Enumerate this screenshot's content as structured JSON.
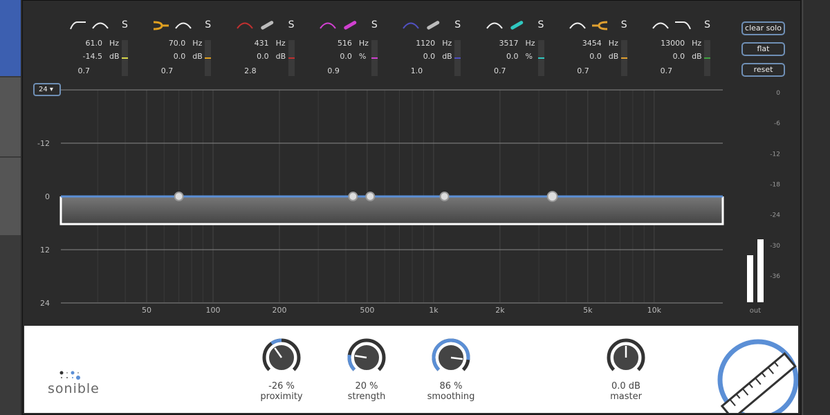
{
  "bands": [
    {
      "freq": "61.0",
      "gain": "-14.5",
      "gain_unit": "dB",
      "q": "0.7",
      "solo": "S",
      "color": "#d8d84a",
      "icons": [
        "highpass-shape-icon",
        "bell-shape-icon"
      ]
    },
    {
      "freq": "70.0",
      "gain": "0.0",
      "gain_unit": "dB",
      "q": "0.7",
      "solo": "S",
      "color": "#e0a020",
      "icons": [
        "smart-filter-icon",
        "bell-shape-icon"
      ]
    },
    {
      "freq": "431",
      "gain": "0.0",
      "gain_unit": "dB",
      "q": "2.8",
      "solo": "S",
      "color": "#c03030",
      "icons": [
        "bell-shape-icon",
        "slider-icon"
      ]
    },
    {
      "freq": "516",
      "gain": "0.0",
      "gain_unit": "%",
      "q": "0.9",
      "solo": "S",
      "color": "#d040d0",
      "icons": [
        "bell-shape-icon",
        "slider-icon"
      ]
    },
    {
      "freq": "1120",
      "gain": "0.0",
      "gain_unit": "dB",
      "q": "1.0",
      "solo": "S",
      "color": "#5050c0",
      "icons": [
        "bell-shape-icon",
        "slider-icon"
      ]
    },
    {
      "freq": "3517",
      "gain": "0.0",
      "gain_unit": "%",
      "q": "0.7",
      "solo": "S",
      "color": "#30c8c0",
      "icons": [
        "bell-shape-icon",
        "slider-icon"
      ]
    },
    {
      "freq": "3454",
      "gain": "0.0",
      "gain_unit": "dB",
      "q": "0.7",
      "solo": "S",
      "color": "#e0a030",
      "icons": [
        "bell-shape-icon",
        "smart-filter-icon"
      ]
    },
    {
      "freq": "13000",
      "gain": "0.0",
      "gain_unit": "dB",
      "q": "0.7",
      "solo": "S",
      "color": "#40a040",
      "icons": [
        "bell-shape-icon",
        "lowpass-shape-icon"
      ]
    }
  ],
  "freq_unit": "Hz",
  "buttons": {
    "clear_solo": "clear solo",
    "flat": "flat",
    "reset": "reset"
  },
  "range_select": "24",
  "db_labels": [
    "-12",
    "0",
    "12",
    "24"
  ],
  "freq_labels": [
    "50",
    "100",
    "200",
    "500",
    "1k",
    "2k",
    "5k",
    "10k"
  ],
  "meter_labels": [
    "0",
    "-6",
    "-12",
    "-18",
    "-24",
    "-30",
    "-36"
  ],
  "meter_label_out": "out",
  "meter_levels_db": [
    -28,
    -32
  ],
  "knobs": [
    {
      "name": "proximity",
      "value": "-26 %",
      "fraction": 0.37
    },
    {
      "name": "strength",
      "value": "20 %",
      "fraction": 0.2
    },
    {
      "name": "smoothing",
      "value": "86 %",
      "fraction": 0.86
    },
    {
      "name": "master",
      "value": "0.0 dB",
      "fraction": 0.5
    }
  ],
  "logo": "sonible",
  "accent": "#5b8fd6"
}
